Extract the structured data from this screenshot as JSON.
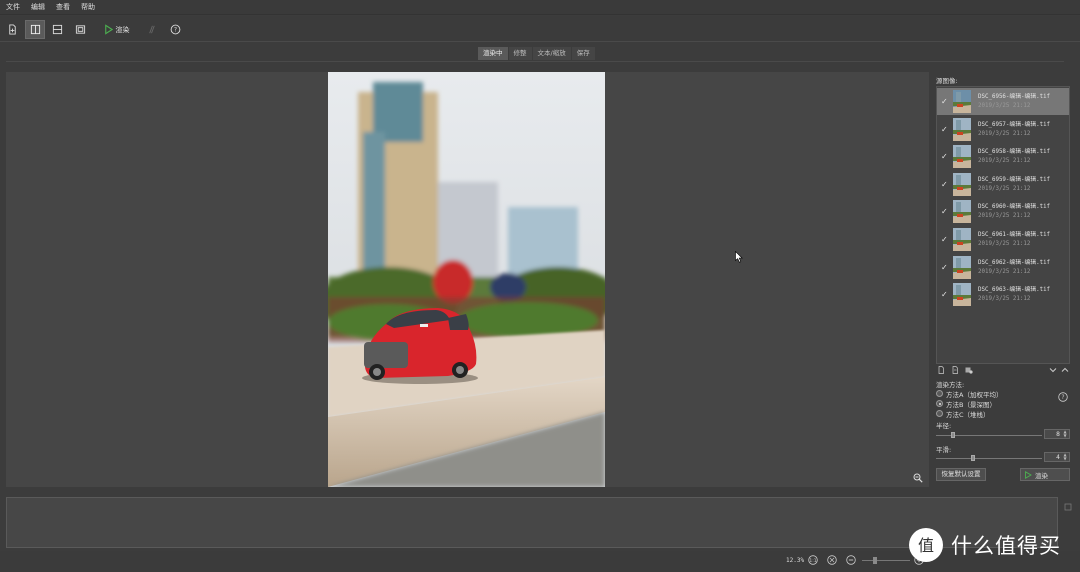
{
  "menu": [
    "文件",
    "编辑",
    "查看",
    "帮助"
  ],
  "toolbar": {
    "render_label": "渲染",
    "icons": [
      "new-file-icon",
      "split-vertical-icon",
      "split-horizontal-icon",
      "frame-icon",
      "play-icon",
      "stack-icon",
      "help-icon"
    ]
  },
  "tabs": [
    {
      "label": "渲染中",
      "active": true
    },
    {
      "label": "修整",
      "active": false
    },
    {
      "label": "文本/缩放",
      "active": false
    },
    {
      "label": "保存",
      "active": false
    }
  ],
  "source_panel": {
    "label": "源图像:",
    "files": [
      {
        "name": "DSC_6956-编辑-编辑.tif",
        "date": "2019/3/25 21:12",
        "checked": true,
        "selected": true
      },
      {
        "name": "DSC_6957-编辑-编辑.tif",
        "date": "2019/3/25 21:12",
        "checked": true,
        "selected": false
      },
      {
        "name": "DSC_6958-编辑-编辑.tif",
        "date": "2019/3/25 21:12",
        "checked": true,
        "selected": false
      },
      {
        "name": "DSC_6959-编辑-编辑.tif",
        "date": "2019/3/25 21:12",
        "checked": true,
        "selected": false
      },
      {
        "name": "DSC_6960-编辑-编辑.tif",
        "date": "2019/3/25 21:12",
        "checked": true,
        "selected": false
      },
      {
        "name": "DSC_6961-编辑-编辑.tif",
        "date": "2019/3/25 21:12",
        "checked": true,
        "selected": false
      },
      {
        "name": "DSC_6962-编辑-编辑.tif",
        "date": "2019/3/25 21:12",
        "checked": true,
        "selected": false
      },
      {
        "name": "DSC_6963-编辑-编辑.tif",
        "date": "2019/3/25 21:12",
        "checked": true,
        "selected": false
      }
    ]
  },
  "render_method": {
    "label": "渲染方法:",
    "options": [
      {
        "label": "方法A（加权平均）",
        "selected": false
      },
      {
        "label": "方法B（景深图）",
        "selected": true
      },
      {
        "label": "方法C（堆栈）",
        "selected": false
      }
    ]
  },
  "params": {
    "radius_label": "半径:",
    "radius_value": "8",
    "radius_fraction": 0.15,
    "smoothing_label": "平滑:",
    "smoothing_value": "4",
    "smoothing_fraction": 0.34
  },
  "buttons": {
    "reset": "恢复默认设置",
    "render": "渲染"
  },
  "status": {
    "zoom": "12.3%",
    "zoom_fraction": 0.25
  },
  "watermark": {
    "text": "什么值得买",
    "logo_glyph": "值"
  }
}
